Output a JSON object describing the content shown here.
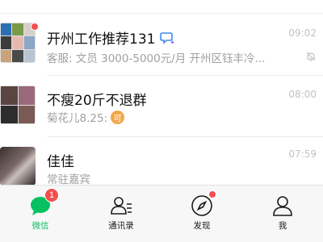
{
  "chats": [
    {
      "title": "开州工作推荐131",
      "subtitle": "客服: 文员 3000-5000元/月 开州区钰丰冷...",
      "time": "09:02",
      "muted": true,
      "unread_dot": true
    },
    {
      "title": "不瘦20斤不退群",
      "subtitle": "菊花儿8.25:",
      "time": "08:00",
      "coin_glyph": "可"
    },
    {
      "title": "佳佳",
      "subtitle": "常驻嘉宾",
      "time": "07:59"
    }
  ],
  "tabbar": {
    "tabs": [
      {
        "label": "微信",
        "active": true,
        "badge": "1"
      },
      {
        "label": "通讯录"
      },
      {
        "label": "发现",
        "dot": true
      },
      {
        "label": "我"
      }
    ]
  },
  "colors": {
    "accent": "#07c160",
    "badge": "#f24f4f",
    "muted_text": "#a0a0a0"
  }
}
